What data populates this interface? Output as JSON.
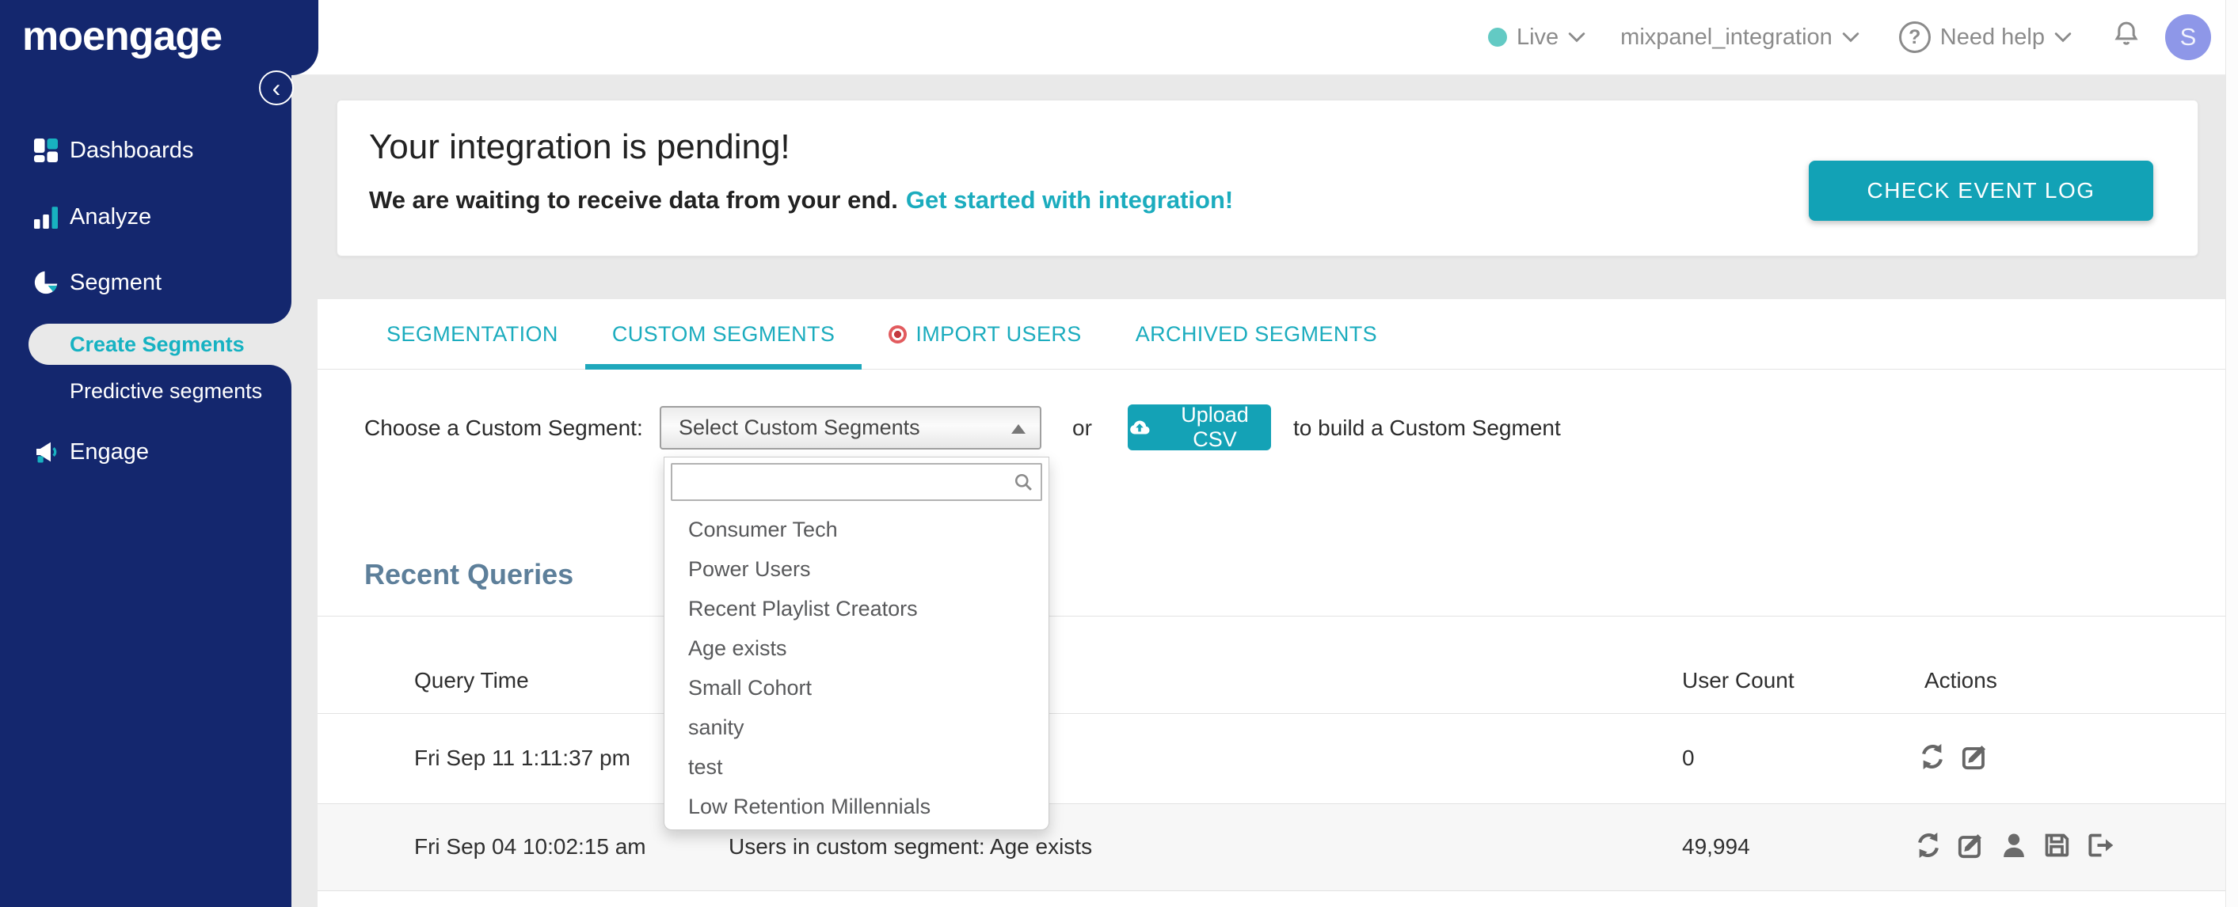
{
  "sidebar": {
    "logo": "moengage",
    "collapse_glyph": "‹",
    "items": [
      {
        "label": "Dashboards"
      },
      {
        "label": "Analyze"
      },
      {
        "label": "Segment"
      },
      {
        "label": "Create Segments"
      },
      {
        "label": "Predictive segments"
      },
      {
        "label": "Engage"
      }
    ]
  },
  "topbar": {
    "live_label": "Live",
    "workspace": "mixpanel_integration",
    "help_glyph": "?",
    "help_label": "Need help",
    "avatar_initial": "S"
  },
  "banner": {
    "title": "Your integration is pending!",
    "message": "We are waiting to receive data from your end.",
    "link": "Get started with integration!",
    "button": "CHECK EVENT LOG"
  },
  "tabs": [
    {
      "label": "SEGMENTATION"
    },
    {
      "label": "CUSTOM SEGMENTS"
    },
    {
      "label": "IMPORT USERS"
    },
    {
      "label": "ARCHIVED SEGMENTS"
    }
  ],
  "picker": {
    "label": "Choose a Custom Segment:",
    "select_value": "Select Custom Segments",
    "or": "or",
    "upload_button": "Upload CSV",
    "suffix": "to build a Custom Segment",
    "options": [
      "Consumer Tech",
      "Power Users",
      "Recent Playlist Creators",
      "Age exists",
      "Small Cohort",
      "sanity",
      "test",
      "Low Retention Millennials"
    ]
  },
  "recent_queries": {
    "heading": "Recent Queries",
    "columns": {
      "query_time": "Query Time",
      "user_count": "User Count",
      "actions": "Actions"
    },
    "rows": [
      {
        "query_time": "Fri Sep 11 1:11:37 pm",
        "user_count": "0"
      },
      {
        "query_time": "Fri Sep 04 10:02:15 am",
        "query": "Users in custom segment: Age exists",
        "user_count": "49,994"
      }
    ]
  },
  "colors": {
    "navy": "#14276e",
    "accent_teal": "#14a2b6",
    "link_teal": "#1bacbe",
    "live_dot": "#63cac4",
    "import_dot": "#e25b5e",
    "heading_slate": "#5d7f9a"
  }
}
